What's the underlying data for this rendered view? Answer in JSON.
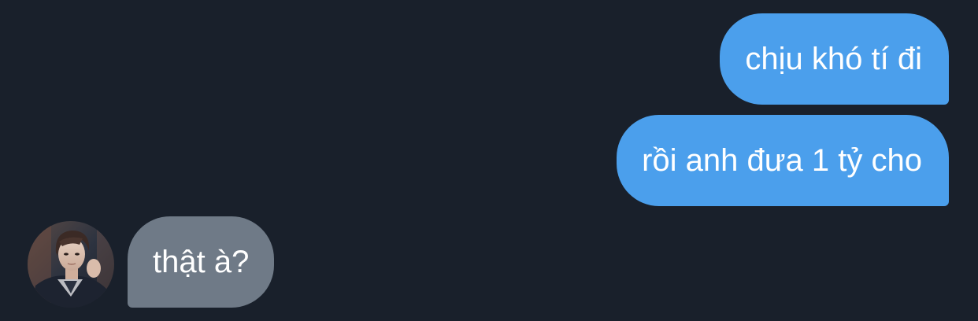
{
  "conversation": {
    "messages": [
      {
        "direction": "outgoing",
        "text": "chịu khó tí đi"
      },
      {
        "direction": "outgoing",
        "text": "rồi anh đưa 1 tỷ cho"
      },
      {
        "direction": "incoming",
        "text": "thật à?"
      }
    ],
    "participant": {
      "avatar_icon": "avatar-photo"
    }
  },
  "colors": {
    "background": "#19202b",
    "outgoing_bubble": "#4b9fec",
    "incoming_bubble": "#6f7a87",
    "text": "#ffffff"
  }
}
